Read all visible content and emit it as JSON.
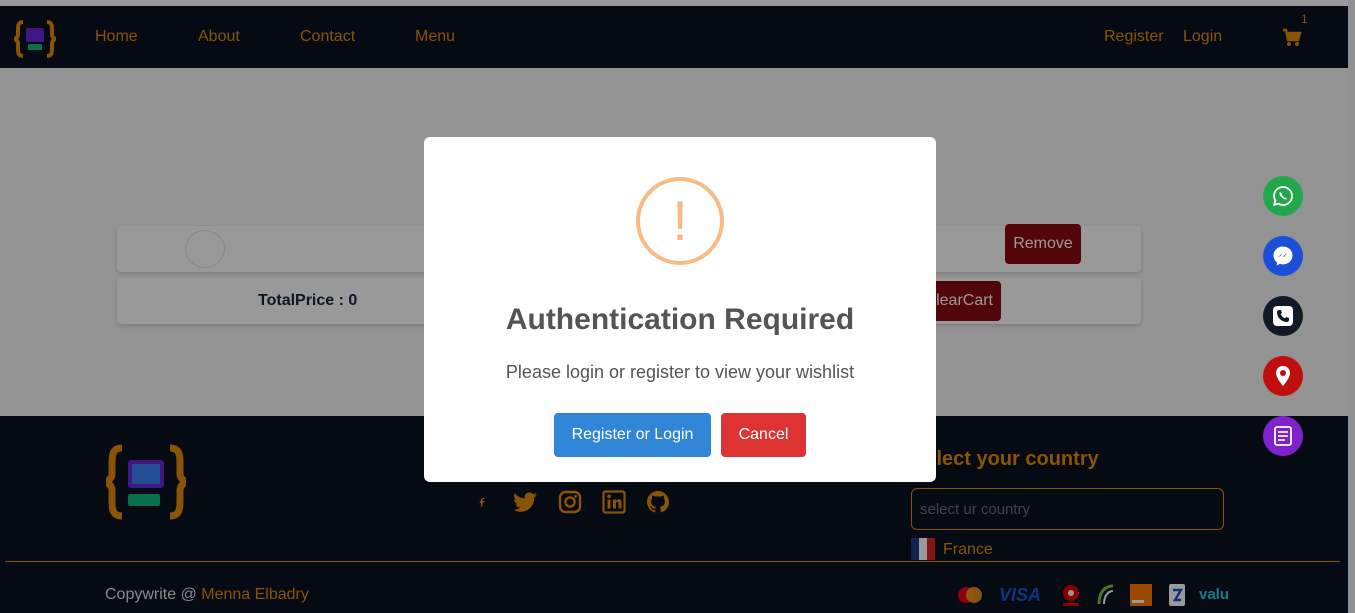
{
  "nav": {
    "home": "Home",
    "about": "About",
    "contact": "Contact",
    "menu": "Menu",
    "register": "Register",
    "login": "Login",
    "cart_count": "1"
  },
  "cart": {
    "remove_label": "Remove",
    "total_label": "TotalPrice : 0",
    "clear_label": "ClearCart"
  },
  "modal": {
    "icon_glyph": "!",
    "title": "Authentication Required",
    "text": "Please login or register to view your wishlist",
    "confirm_label": "Register or Login",
    "cancel_label": "Cancel"
  },
  "floating": [
    "whatsapp-icon",
    "messenger-icon",
    "phone-icon",
    "location-icon",
    "notes-icon"
  ],
  "footer": {
    "country_title": "Select your country",
    "country_placeholder": "select ur country",
    "selected_country": "France",
    "copyright_prefix": "Copywrite @ ",
    "copyright_author": "Menna Elbadry",
    "social": [
      "facebook-icon",
      "twitter-icon",
      "instagram-icon",
      "linkedin-icon",
      "github-icon"
    ],
    "payments": [
      "mastercard-icon",
      "visa-icon",
      "vodafone-icon",
      "etisalat-icon",
      "orange-icon",
      "fawry-icon",
      "valu-icon"
    ],
    "payment_text": {
      "visa": "VISA",
      "valu": "valu"
    }
  },
  "colors": {
    "accent": "#e58a0e",
    "navy": "#0b1120",
    "danger": "#8b0b12",
    "confirm": "#3085d6",
    "cancel": "#dd3333",
    "warning": "#f8bb86"
  }
}
